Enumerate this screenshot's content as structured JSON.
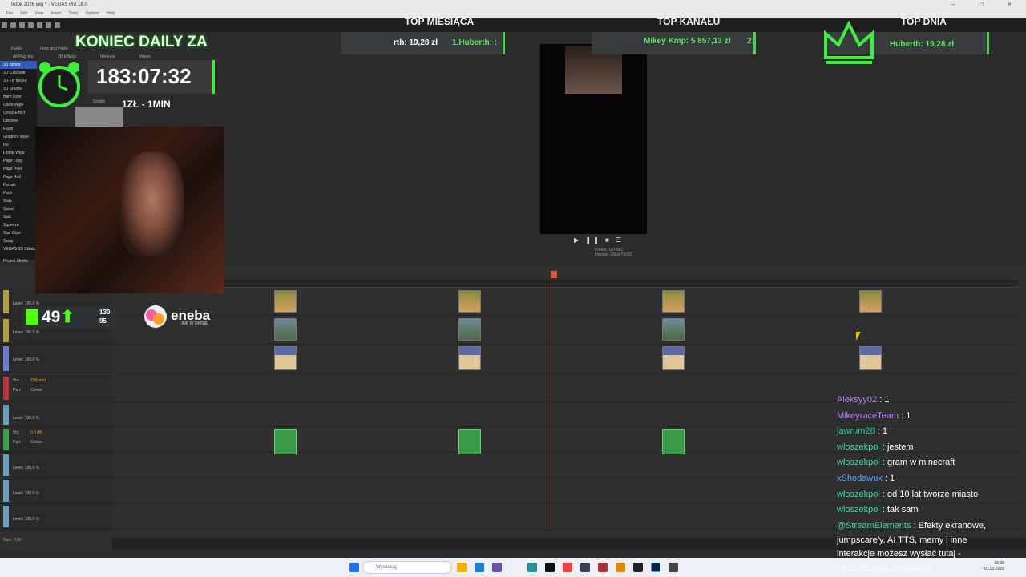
{
  "window": {
    "title": "tiktok 2026.veg * - VEGAS Pro 18.0"
  },
  "menu": [
    "File",
    "Edit",
    "View",
    "Insert",
    "Tools",
    "Options",
    "Help"
  ],
  "fx_tabs": [
    "Fades",
    "Loop and Peels",
    "All Plug-Ins",
    "3D Effects",
    "Reveals",
    "Wipes",
    "Simple"
  ],
  "transitions": [
    "3D Blinds",
    "3D Cascade",
    "3D Fly In/Out",
    "3D Shuffle",
    "Barn Door",
    "Clock Wipe",
    "Cross Effect",
    "Dissolve",
    "Flash",
    "Gradient Wipe",
    "Iris",
    "Linear Wipe",
    "Page Loop",
    "Page Peel",
    "Page Roll",
    "Portals",
    "Push",
    "Slide",
    "Spiral",
    "Split",
    "Squeeze",
    "Star Wipe",
    "Swap",
    "VEGAS 3D Blinds"
  ],
  "project_media_label": "Project Media",
  "preview": {
    "frame": "Frame:    167 681",
    "display": "Display:  266x473x32"
  },
  "tracks": [
    {
      "level": "Level: 100,0 %"
    },
    {
      "level": "Level: 100,0 %"
    },
    {
      "level": "Level: 100,0 %"
    },
    {
      "vol": "Vol:",
      "vol_val": "Off(solo)",
      "pan": "Pan:",
      "pan_val": "Center"
    },
    {
      "level": "Level: 100,0 %"
    },
    {
      "vol": "Vol:",
      "vol_val": "0,0 dB",
      "pan": "Pan:",
      "pan_val": "Center"
    },
    {
      "level": "Level: 100,0 %"
    },
    {
      "level": "Level: 100,0 %"
    },
    {
      "level": "Level: 100,0 %"
    }
  ],
  "rate": "Rate: 0,00",
  "taskbar": {
    "search_placeholder": "Wyszukaj",
    "time": "02:08",
    "date": "01.03.2026"
  },
  "overlay": {
    "top_month": {
      "heading": "TOP MIESIĄCA",
      "entry1": "rth: 19,28 zł",
      "entry2": "1.Huberth: :"
    },
    "top_channel": {
      "heading": "TOP KANAŁU",
      "entry": "Mikey Kmp: 5 857,13 zł",
      "entry2": "2"
    },
    "top_day": {
      "heading": "TOP DNIA",
      "entry": "Huberth: 19,28 zł"
    },
    "daily_title": "KONIEC DAILY ZA",
    "timer": "183:07:32",
    "rate": "1ZŁ - 1MIN",
    "kick": {
      "count": "49",
      "viewers": "130",
      "followers": "95"
    },
    "sponsor": {
      "name": "eneba",
      "sub": "LINK W OPISIE"
    }
  },
  "chat": [
    {
      "user": "Aleksyy02",
      "color": "#b77cff",
      "msg": "1"
    },
    {
      "user": "MikeyraceTeam",
      "color": "#c07bff",
      "msg": "1"
    },
    {
      "user": "jawrum28",
      "color": "#22cc99",
      "msg": "1"
    },
    {
      "user": "wloszekpol",
      "color": "#3fd6b0",
      "msg": "jestem"
    },
    {
      "user": "wloszekpol",
      "color": "#3fd6b0",
      "msg": "gram w minecraft"
    },
    {
      "user": "xShodawux",
      "color": "#5aa0ff",
      "msg": "1"
    },
    {
      "user": "wloszekpol",
      "color": "#3fd6b0",
      "msg": "od 10 lat tworze miasto"
    },
    {
      "user": "wloszekpol",
      "color": "#3fd6b0",
      "msg": "tak sam"
    },
    {
      "user": "@StreamElements",
      "color": "#3fd6b0",
      "msg": "Efekty ekranowe,"
    }
  ],
  "chat_cont": [
    "jumpscare'y, AI TTS, memy i inne",
    "interakcje możesz wysłać tutaj -"
  ],
  "url": "https://tangia.co/viniplay"
}
